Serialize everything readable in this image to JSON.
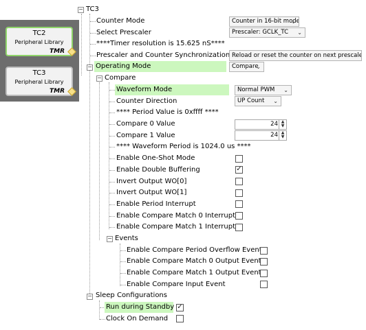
{
  "components": {
    "tc2": {
      "title": "TC2",
      "library": "Peripheral Library",
      "badge": "TMR"
    },
    "tc3": {
      "title": "TC3",
      "library": "Peripheral Library",
      "badge": "TMR"
    }
  },
  "tree": {
    "root": "TC3",
    "counter_mode": {
      "label": "Counter Mode",
      "value": "Counter in 16-bit mode"
    },
    "select_prescaler": {
      "label": "Select Prescaler",
      "value": "Prescaler: GCLK_TC"
    },
    "timer_resolution": "****Timer resolution is 15.625 nS****",
    "prescaler_sync": {
      "label": "Prescaler and Counter Synchronization",
      "value": "Reload or reset the counter on next prescaler clock"
    },
    "operating_mode": {
      "label": "Operating Mode",
      "value": "Compare"
    },
    "compare": "Compare",
    "waveform_mode": {
      "label": "Waveform Mode",
      "value": "Normal PWM"
    },
    "counter_direction": {
      "label": "Counter Direction",
      "value": "UP Count"
    },
    "period_value": "**** Period Value is 0xffff ****",
    "compare0": {
      "label": "Compare 0 Value",
      "value": "24"
    },
    "compare1": {
      "label": "Compare 1 Value",
      "value": "24"
    },
    "waveform_period": "**** Waveform Period is 1024.0 us ****",
    "one_shot": {
      "label": "Enable One-Shot Mode",
      "checked": false
    },
    "double_buffering": {
      "label": "Enable Double Buffering",
      "checked": true
    },
    "invert_wo0": {
      "label": "Invert Output WO[0]",
      "checked": false
    },
    "invert_wo1": {
      "label": "Invert Output WO[1]",
      "checked": false
    },
    "period_interrupt": {
      "label": "Enable Period Interrupt",
      "checked": false
    },
    "cm0_interrupt": {
      "label": "Enable Compare Match 0 Interrupt",
      "checked": false
    },
    "cm1_interrupt": {
      "label": "Enable Compare Match 1 Interrupt",
      "checked": false
    },
    "events": "Events",
    "ev_period_overflow": {
      "label": "Enable Compare Period Overflow Event",
      "checked": false
    },
    "ev_cm0_output": {
      "label": "Enable Compare Match 0 Output Event",
      "checked": false
    },
    "ev_cm1_output": {
      "label": "Enable Compare Match 1 Output Event",
      "checked": false
    },
    "ev_compare_input": {
      "label": "Enable Compare Input Event",
      "checked": false
    },
    "sleep": "Sleep Configurations",
    "run_standby": {
      "label": "Run during Standby",
      "checked": true
    },
    "clock_on_demand": {
      "label": "Clock On Demand",
      "checked": false
    }
  },
  "colors": {
    "highlight": "#ccf7be",
    "panel": "#6d6d6d",
    "selected_border": "#8fd46a"
  }
}
